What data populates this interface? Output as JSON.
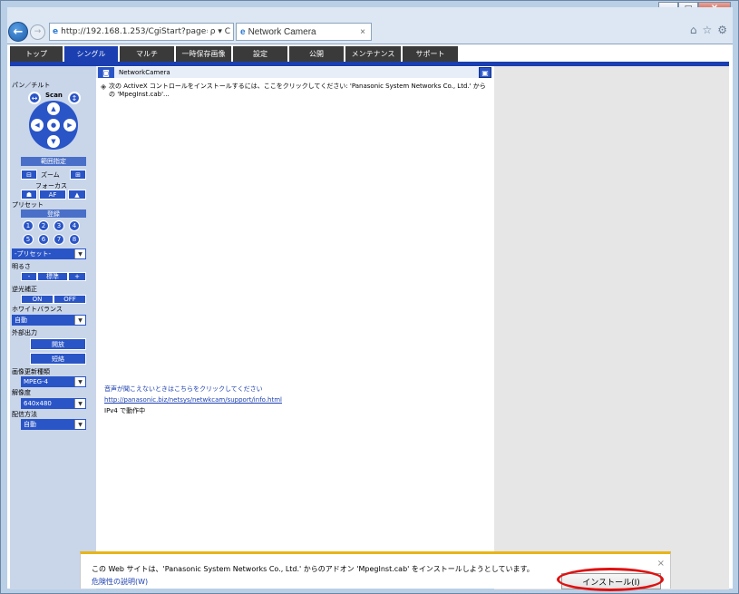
{
  "browser": {
    "url": "http://192.168.1.253/CgiStart?page=S",
    "addr_controls": "ρ ▾ C",
    "tab_title": "Network Camera",
    "tab_close": "×",
    "window_buttons": [
      "–",
      "□",
      "X"
    ]
  },
  "menu_tabs": [
    {
      "label": "トップ",
      "active": false
    },
    {
      "label": "シングル",
      "active": true
    },
    {
      "label": "マルチ",
      "active": false
    },
    {
      "label": "一時保存画像",
      "active": false
    },
    {
      "label": "設定",
      "active": false
    },
    {
      "label": "公開",
      "active": false
    },
    {
      "label": "メンテナンス",
      "active": false
    },
    {
      "label": "サポート",
      "active": false
    }
  ],
  "left_panel": {
    "pan_tilt_label": "パン／チルト",
    "scan_label": "Scan",
    "range_label": "範囲指定",
    "zoom_label": "ズーム",
    "focus_label": "フォーカス",
    "af_label": "AF",
    "preset_label": "プリセット",
    "register_label": "登録",
    "preset_numbers": [
      "1",
      "2",
      "3",
      "4",
      "5",
      "6",
      "7",
      "8"
    ],
    "preset_select": "-プリセット-",
    "brightness_label": "明るさ",
    "brightness_minus": "-",
    "brightness_std": "標準",
    "brightness_plus": "+",
    "backlight_label": "逆光補正",
    "backlight_on": "ON",
    "backlight_off": "OFF",
    "wb_label": "ホワイトバランス",
    "wb_value": "自動",
    "ext_out_label": "外部出力",
    "ext_open": "開放",
    "ext_short": "短絡",
    "format_label": "画像更新種類",
    "format_value": "MPEG-4",
    "resolution_label": "解像度",
    "resolution_value": "640x480",
    "delivery_label": "配信方法",
    "delivery_value": "自動"
  },
  "viewer": {
    "title": "NetworkCamera",
    "message": "次の ActiveX コントロールをインストールするには、ここをクリックしてください: 'Panasonic System Networks Co., Ltd.' からの 'MpegInst.cab'..."
  },
  "below_viewer": {
    "audio_link": "音声が聞こえないときはこちらをクリックしてください",
    "support_url": "http://panasonic.biz/netsys/netwkcam/support/info.html",
    "ipv4_status": "IPv4 で動作中"
  },
  "notification": {
    "message": "この Web サイトは、'Panasonic System Networks Co., Ltd.' からのアドオン 'MpegInst.cab' をインストールしようとしています。",
    "risk_link": "危険性の説明(W)",
    "install_button": "インストール(I)",
    "close": "×"
  },
  "colors": {
    "accent": "#1b3fb0",
    "panel": "#c9d6ea",
    "notification_border": "#e8b418",
    "highlight_ring": "#e01010"
  }
}
